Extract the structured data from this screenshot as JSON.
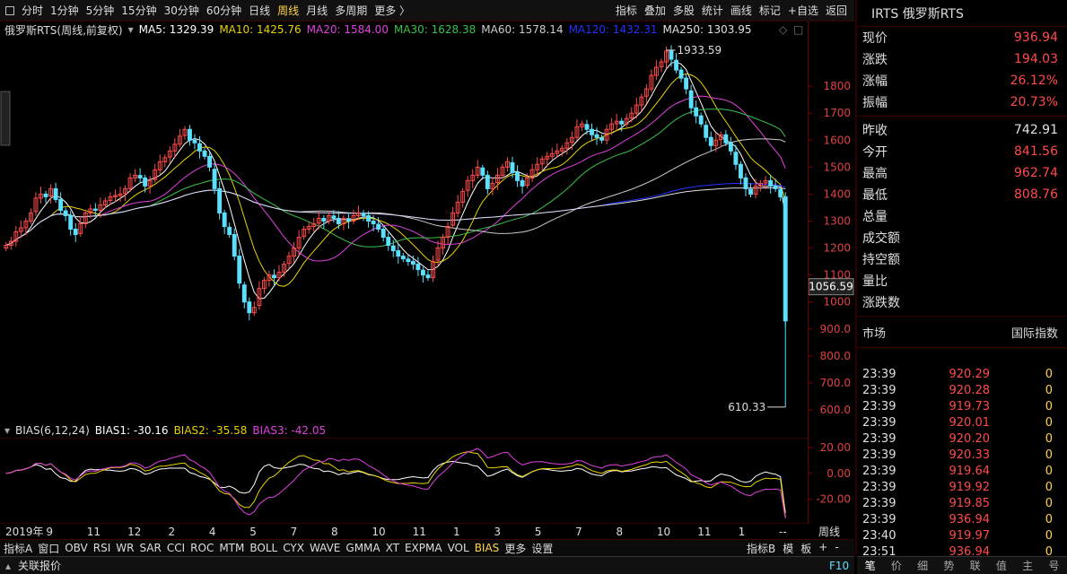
{
  "toolbar": {
    "left_items": [
      "分时",
      "1分钟",
      "5分钟",
      "15分钟",
      "30分钟",
      "60分钟",
      "日线",
      "周线",
      "月线",
      "多周期",
      "更多 〉"
    ],
    "active_index": 7,
    "right_items": [
      "指标",
      "叠加",
      "多股",
      "统计",
      "画线",
      "标记",
      "+自选",
      "返回"
    ]
  },
  "info": {
    "name": "俄罗斯RTS",
    "mode": "(周线,前复权)",
    "ma5": "MA5: 1329.39",
    "ma10": "MA10: 1425.76",
    "ma20": "MA20: 1584.00",
    "ma30": "MA30: 1628.38",
    "ma60": "MA60: 1578.14",
    "ma120": "MA120: 1432.31",
    "ma250": "MA250: 1303.95"
  },
  "colors": {
    "up": "#ff4a4a",
    "down": "#5be0ff",
    "ma5": "#ffffff",
    "ma10": "#e8d200",
    "ma20": "#e040e0",
    "ma30": "#39c24a",
    "ma60": "#cccccc",
    "ma120": "#2233ff",
    "ma250": "#e0e0e0"
  },
  "chart_data": {
    "type": "line",
    "title": "俄罗斯RTS (周线,前复权)",
    "y_ticks": [
      1800,
      1700,
      1600,
      1500,
      1400,
      1300,
      1200,
      1100,
      1000,
      900,
      800,
      700,
      600
    ],
    "y_tick_labels": [
      "1800",
      "1700",
      "1600",
      "1500",
      "1400",
      "1300",
      "1200",
      "1100",
      "1000",
      "900.0",
      "800.0",
      "700.0",
      "600.0"
    ],
    "ylim": [
      590,
      1960
    ],
    "annotations": {
      "high": "1933.59",
      "low": "610.33",
      "crosshair": "1056.59"
    },
    "x_labels": [
      "2019年",
      "9",
      "11",
      "12",
      "2",
      "4",
      "5",
      "7",
      "8",
      "10",
      "11",
      "1",
      "3",
      "5",
      "7",
      "8",
      "10",
      "11",
      "1",
      "--"
    ],
    "close": [
      1210,
      1225,
      1260,
      1275,
      1300,
      1330,
      1385,
      1400,
      1390,
      1420,
      1380,
      1340,
      1320,
      1270,
      1250,
      1290,
      1330,
      1345,
      1340,
      1360,
      1375,
      1390,
      1395,
      1400,
      1420,
      1460,
      1470,
      1460,
      1430,
      1450,
      1490,
      1520,
      1535,
      1560,
      1585,
      1615,
      1640,
      1600,
      1590,
      1560,
      1540,
      1500,
      1420,
      1330,
      1280,
      1250,
      1170,
      1070,
      1000,
      960,
      980,
      1050,
      1080,
      1100,
      1090,
      1110,
      1140,
      1170,
      1200,
      1240,
      1270,
      1280,
      1290,
      1310,
      1300,
      1320,
      1310,
      1290,
      1310,
      1300,
      1320,
      1330,
      1320,
      1300,
      1290,
      1270,
      1240,
      1210,
      1190,
      1170,
      1160,
      1150,
      1140,
      1120,
      1100,
      1090,
      1150,
      1200,
      1240,
      1280,
      1330,
      1370,
      1410,
      1450,
      1470,
      1500,
      1470,
      1420,
      1440,
      1470,
      1500,
      1520,
      1480,
      1450,
      1430,
      1460,
      1490,
      1510,
      1530,
      1540,
      1550,
      1560,
      1570,
      1590,
      1610,
      1650,
      1660,
      1640,
      1620,
      1610,
      1600,
      1640,
      1660,
      1670,
      1660,
      1680,
      1700,
      1730,
      1760,
      1790,
      1840,
      1870,
      1890,
      1930,
      1900,
      1860,
      1830,
      1790,
      1720,
      1690,
      1660,
      1610,
      1580,
      1600,
      1620,
      1590,
      1560,
      1510,
      1460,
      1420,
      1400,
      1430,
      1440,
      1450,
      1430,
      1420,
      1390,
      930
    ],
    "bias": {
      "params": "BIAS(6,12,24)",
      "bias1": "BIAS1: -30.16",
      "bias2": "BIAS2: -35.58",
      "bias3": "BIAS3: -42.05",
      "y_ticks": [
        20,
        0,
        -20
      ],
      "y_tick_labels": [
        "20.00",
        "0.00",
        "-20.00"
      ]
    }
  },
  "right_panel": {
    "title": "IRTS 俄罗斯RTS",
    "quote": [
      {
        "label": "现价",
        "value": "936.94",
        "color": "red"
      },
      {
        "label": "涨跌",
        "value": "194.03",
        "color": "red"
      },
      {
        "label": "涨幅",
        "value": "26.12%",
        "color": "red"
      },
      {
        "label": "振幅",
        "value": "20.73%",
        "color": "red"
      }
    ],
    "stats": [
      {
        "label": "昨收",
        "value": "742.91",
        "color": "white"
      },
      {
        "label": "今开",
        "value": "841.56",
        "color": "red"
      },
      {
        "label": "最高",
        "value": "962.74",
        "color": "red"
      },
      {
        "label": "最低",
        "value": "808.76",
        "color": "red"
      },
      {
        "label": "总量",
        "value": "",
        "color": "white"
      },
      {
        "label": "成交额",
        "value": "",
        "color": "white"
      },
      {
        "label": "持空额",
        "value": "",
        "color": "white"
      },
      {
        "label": "量比",
        "value": "",
        "color": "white"
      },
      {
        "label": "涨跌数",
        "value": "",
        "color": "white"
      }
    ],
    "market_label": "市场",
    "market_value": "国际指数",
    "ticks": [
      [
        "23:39",
        "920.29",
        "0"
      ],
      [
        "23:39",
        "920.28",
        "0"
      ],
      [
        "23:39",
        "919.73",
        "0"
      ],
      [
        "23:39",
        "920.01",
        "0"
      ],
      [
        "23:39",
        "920.20",
        "0"
      ],
      [
        "23:39",
        "920.33",
        "0"
      ],
      [
        "23:39",
        "919.64",
        "0"
      ],
      [
        "23:39",
        "919.92",
        "0"
      ],
      [
        "23:39",
        "919.85",
        "0"
      ],
      [
        "23:39",
        "936.94",
        "0"
      ],
      [
        "23:40",
        "919.97",
        "0"
      ],
      [
        "23:51",
        "936.94",
        "0"
      ]
    ],
    "bottom_tabs": [
      "笔",
      "价",
      "细",
      "势",
      "联",
      "值",
      "主",
      "号"
    ]
  },
  "indicator_bar": {
    "items": [
      "指标A",
      "窗口",
      "OBV",
      "RSI",
      "WR",
      "SAR",
      "CCI",
      "ROC",
      "MTM",
      "BOLL",
      "CYX",
      "WAVE",
      "GMMA",
      "XT",
      "EXPMA",
      "VOL",
      "BIAS",
      "更多",
      "设置"
    ],
    "active": "BIAS",
    "right_items": [
      "指标B",
      "模",
      "板",
      "+",
      "-"
    ],
    "period_label": "周线"
  },
  "status": {
    "left": "关联报价",
    "right": "F10"
  }
}
